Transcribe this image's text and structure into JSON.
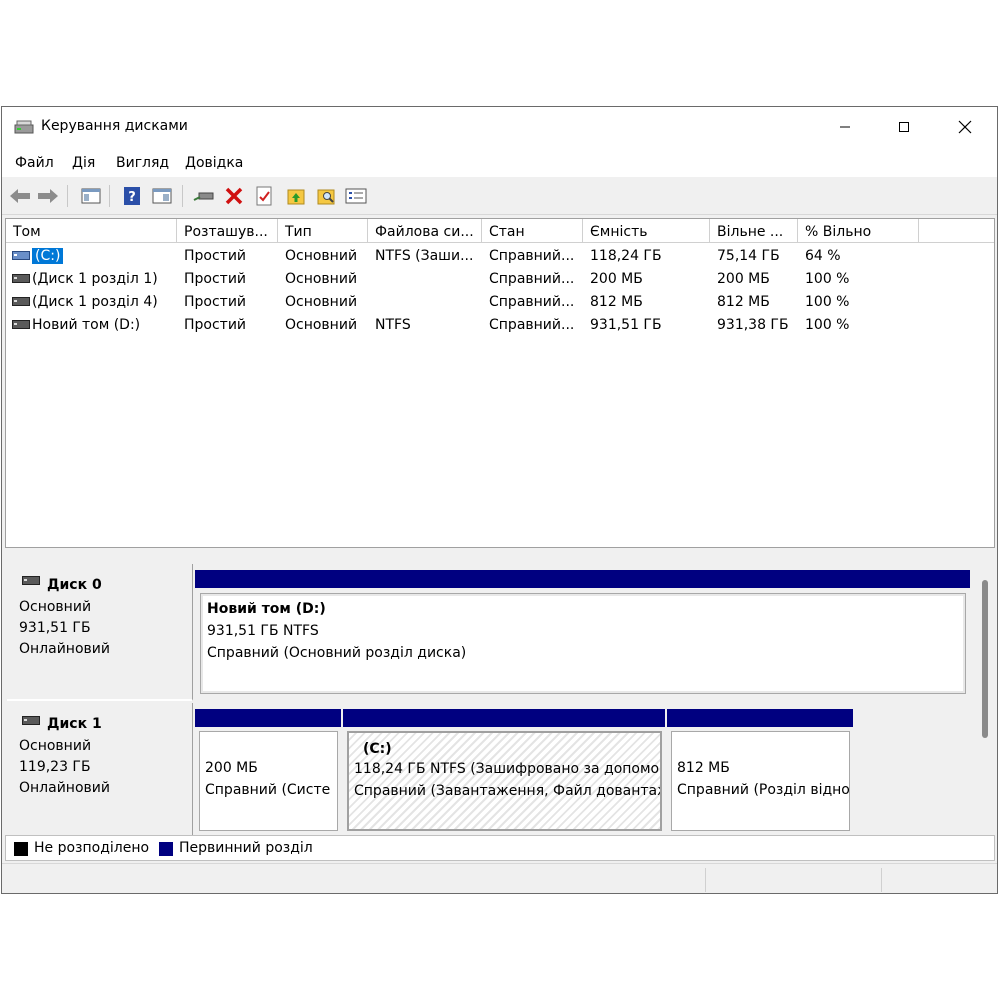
{
  "window": {
    "title": "Керування дисками",
    "icon": "disk-management-icon"
  },
  "menu": [
    "Файл",
    "Дія",
    "Вигляд",
    "Довідка"
  ],
  "toolbar": {
    "icons": [
      "back-arrow-icon",
      "forward-arrow-icon",
      "console-tree-icon",
      "help-icon",
      "properties-panel-icon",
      "connect-disk-icon",
      "delete-icon",
      "checklist-icon",
      "folder-up-icon",
      "folder-search-icon",
      "properties-icon"
    ]
  },
  "columns": [
    "Том",
    "Розташув...",
    "Тип",
    "Файлова си...",
    "Стан",
    "Ємність",
    "Вільне ...",
    "% Вільно"
  ],
  "volumes": [
    {
      "name": "(C:)",
      "layout": "Простий",
      "type": "Основний",
      "fs": "NTFS (Заши...",
      "status": "Справний...",
      "capacity": "118,24 ГБ",
      "free": "75,14 ГБ",
      "pct": "64 %",
      "selected": true
    },
    {
      "name": "(Диск 1 розділ 1)",
      "layout": "Простий",
      "type": "Основний",
      "fs": "",
      "status": "Справний...",
      "capacity": "200 МБ",
      "free": "200 МБ",
      "pct": "100 %"
    },
    {
      "name": "(Диск 1 розділ 4)",
      "layout": "Простий",
      "type": "Основний",
      "fs": "",
      "status": "Справний...",
      "capacity": "812 МБ",
      "free": "812 МБ",
      "pct": "100 %"
    },
    {
      "name": "Новий том (D:)",
      "layout": "Простий",
      "type": "Основний",
      "fs": "NTFS",
      "status": "Справний...",
      "capacity": "931,51 ГБ",
      "free": "931,38 ГБ",
      "pct": "100 %"
    }
  ],
  "disks": [
    {
      "title": "Диск 0",
      "kind": "Основний",
      "size": "931,51 ГБ",
      "state": "Онлайновий",
      "partitions": [
        {
          "title": "Новий том  (D:)",
          "size_fs": "931,51 ГБ NTFS",
          "status": "Справний (Основний розділ диска)"
        }
      ]
    },
    {
      "title": "Диск 1",
      "kind": "Основний",
      "size": "119,23 ГБ",
      "state": "Онлайновий",
      "partitions": [
        {
          "title": "",
          "size_fs": "200 МБ",
          "status": "Справний (Систе"
        },
        {
          "title": "(C:)",
          "size_fs": "118,24 ГБ NTFS (Зашифровано за допомо",
          "status": "Справний (Завантаження, Файл довантаж"
        },
        {
          "title": "",
          "size_fs": "812 МБ",
          "status": "Справний (Розділ відно"
        }
      ]
    }
  ],
  "legend": [
    {
      "label": "Не розподілено",
      "color": "#000000"
    },
    {
      "label": "Первинний розділ",
      "color": "#000080"
    }
  ],
  "colors": {
    "primary_partition": "#000080",
    "selection": "#0078d7",
    "delete_red": "#e81123"
  }
}
